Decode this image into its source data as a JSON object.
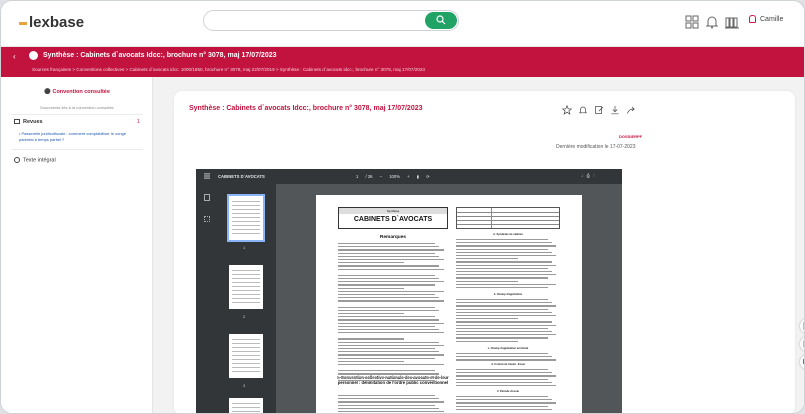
{
  "app": {
    "logo": "lexbase",
    "user_name": "Camille"
  },
  "colors": {
    "brand": "#c2123e",
    "search_button": "#21a366",
    "logo_dash": "#e8a33a"
  },
  "header": {
    "title": "Synthèse : Cabinets d`avocats Idcc:, brochure n° 3078, maj 17/07/2023",
    "breadcrumb": "Sources françaises > Conventions collectives > Cabinets d`avocats idcc: 1000/1850, brochure n° 3078, maj 22/07/2019 > Synthèse : Cabinets d`avocats idcc:, brochure n° 3078, maj 17/07/2023"
  },
  "sidebar": {
    "convention_label": "Convention consultée",
    "linked_docs": "Documents liés à la convention consultée",
    "revues_label": "Revues",
    "revues_count": "1",
    "revue_item": "• Passerelle juridicofiscale : comment comptabiliser le congé parental à temps partiel ?",
    "texte_integral": "Texte intégral"
  },
  "document": {
    "title": "Synthèse : Cabinets d`avocats Idcc:, brochure n° 3078, maj 17/07/2023",
    "tag": "DOSSIERPF",
    "modified": "Dernière modification le 17-07-2023"
  },
  "viewer": {
    "doc_name": "CABINETS D`AVOCATS",
    "page_current": "1",
    "page_total": "/ 26",
    "zoom": "100%",
    "thumb_numbers": [
      "1",
      "2",
      "3"
    ],
    "page_header_small": "Synthèse",
    "page_header_big": "CABINETS D`AVOCATS",
    "remarques": "Remarques",
    "section1": "I. Convention collective nationale des avocats et de leur personnel : délimitation de l'ordre public conventionnel",
    "right_a": "A. Syndicats de salariés",
    "right_b": "b. Champ d'application",
    "right_c": "c. Champ d'application territorial",
    "right_d": "d. Contrat de travail - Essai",
    "right_e": "2. Période d'essai"
  }
}
